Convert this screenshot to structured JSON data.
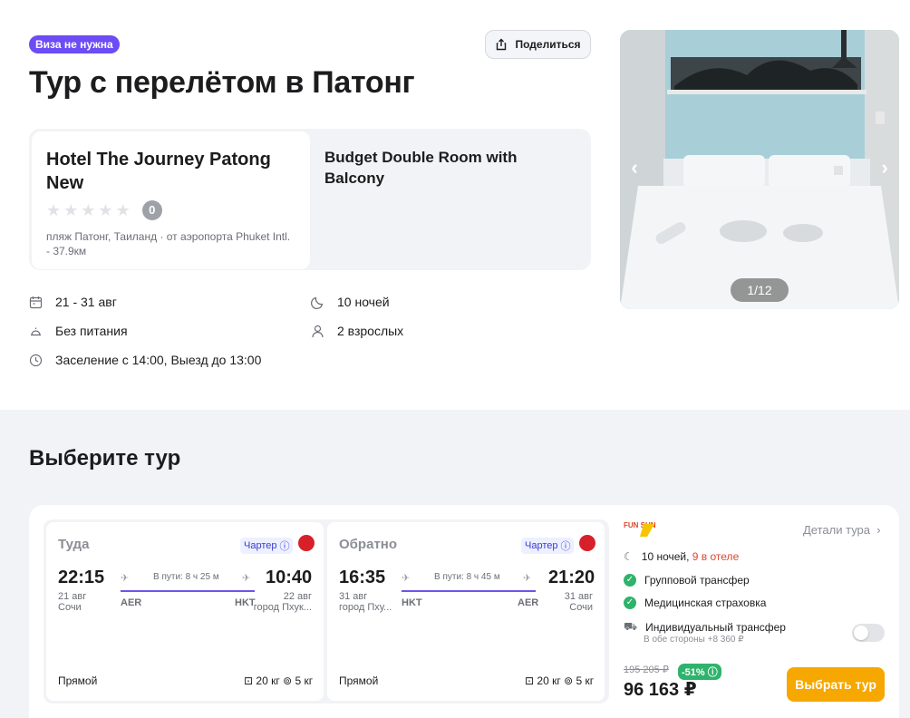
{
  "header": {
    "visa_badge": "Виза не нужна",
    "share_label": "Поделиться",
    "title": "Тур с перелётом в Патонг"
  },
  "hotel": {
    "name": "Hotel The Journey Patong New",
    "stars_filled": 0,
    "rating": "0",
    "location": "пляж Патонг, Таиланд · от аэропорта Phuket Intl. - 37.9км",
    "room": "Budget Double Room with Balcony"
  },
  "info": {
    "dates": "21 - 31 авг",
    "nights": "10 ночей",
    "meal": "Без питания",
    "guests": "2 взрослых",
    "checkin": "Заселение с 14:00, Выезд до 13:00"
  },
  "photo": {
    "counter": "1/12"
  },
  "section": {
    "title": "Выберите тур"
  },
  "flights": {
    "outbound": {
      "direction": "Туда",
      "charter": "Чартер",
      "depart_time": "22:15",
      "depart_date": "21 авг",
      "depart_city": "Сочи",
      "transit": "В пути: 8 ч 25 м",
      "arrive_time": "10:40",
      "arrive_date": "22 авг",
      "arrive_city": "город Пхук...",
      "from_iata": "AER",
      "to_iata": "HKT",
      "type": "Прямой",
      "baggage": "20 кг",
      "hand": "5 кг"
    },
    "inbound": {
      "direction": "Обратно",
      "charter": "Чартер",
      "depart_time": "16:35",
      "depart_date": "31 авг",
      "depart_city": "город Пху...",
      "transit": "В пути: 8 ч 45 м",
      "arrive_time": "21:20",
      "arrive_date": "31 авг",
      "arrive_city": "Сочи",
      "from_iata": "HKT",
      "to_iata": "AER",
      "type": "Прямой",
      "baggage": "20 кг",
      "hand": "5 кг"
    }
  },
  "offer": {
    "operator_logo_text": "FUN SUN",
    "details_label": "Детали тура",
    "nights": "10 ночей,",
    "hotel_nights": "9 в отеле",
    "group_transfer": "Групповой трансфер",
    "insurance": "Медицинская страховка",
    "individual_transfer": "Индивидуальный трансфер",
    "individual_transfer_sub": "В обе стороны +8 360 ₽",
    "individual_transfer_on": false,
    "old_price": "195 205 ₽",
    "discount": "-51%",
    "price": "96 163 ₽",
    "select_label": "Выбрать тур"
  },
  "colors": {
    "accent_purple": "#6c4cf4",
    "button_orange": "#f6a700",
    "success_green": "#2fb36c",
    "nights_red": "#e0452c"
  }
}
